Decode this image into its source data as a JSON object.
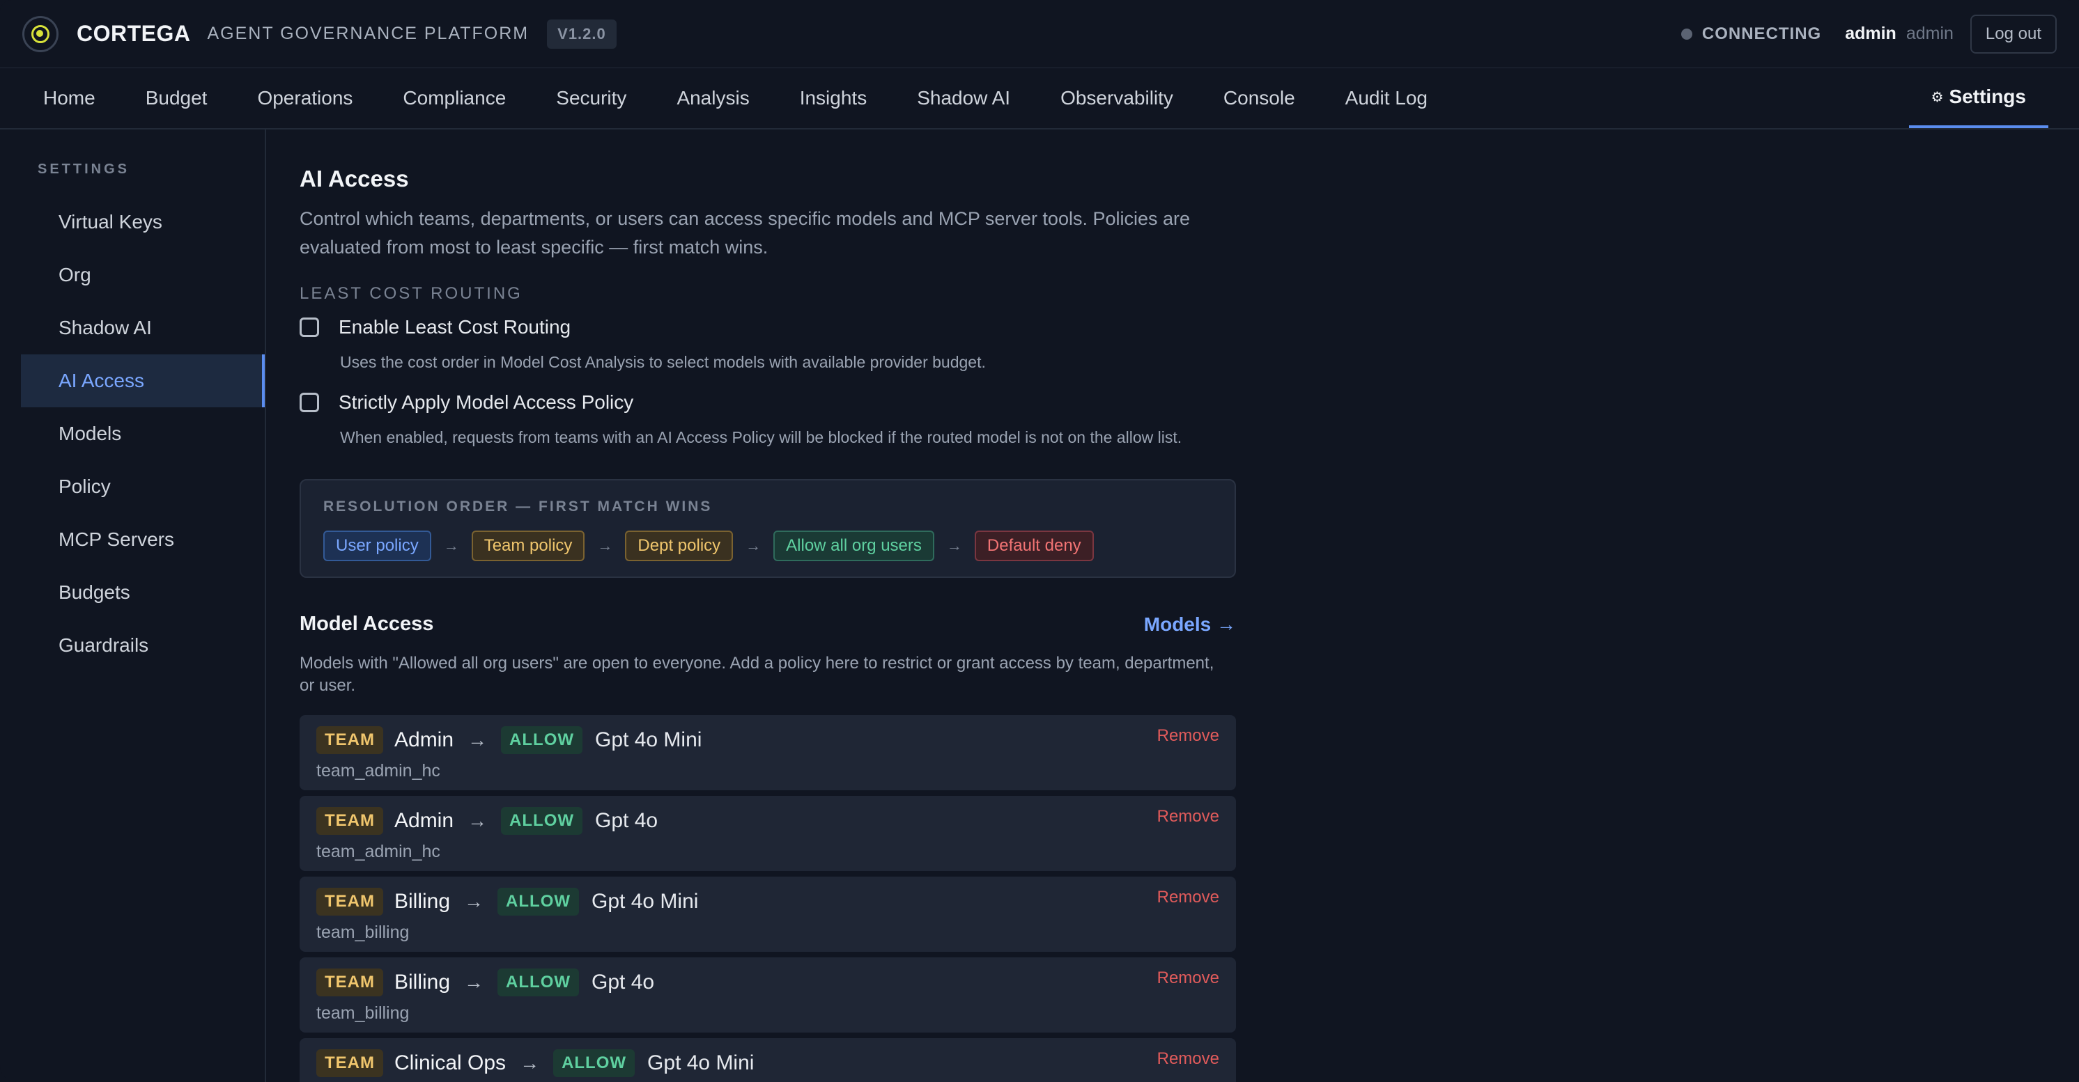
{
  "header": {
    "brand": "CORTEGA",
    "subtitle": "AGENT GOVERNANCE PLATFORM",
    "version": "V1.2.0",
    "status": "CONNECTING",
    "user_name": "admin",
    "user_role": "admin",
    "logout_label": "Log out"
  },
  "nav": {
    "items": [
      "Home",
      "Budget",
      "Operations",
      "Compliance",
      "Security",
      "Analysis",
      "Insights",
      "Shadow AI",
      "Observability",
      "Console",
      "Audit Log"
    ],
    "settings_label": "Settings",
    "settings_icon": "gear-icon"
  },
  "sidebar": {
    "heading": "SETTINGS",
    "items": [
      "Virtual Keys",
      "Org",
      "Shadow AI",
      "AI Access",
      "Models",
      "Policy",
      "MCP Servers",
      "Budgets",
      "Guardrails"
    ],
    "active": "AI Access"
  },
  "main": {
    "title": "AI Access",
    "description": "Control which teams, departments, or users can access specific models and MCP server tools. Policies are evaluated from most to least specific — first match wins.",
    "lcr_heading": "LEAST COST ROUTING",
    "options": [
      {
        "label": "Enable Least Cost Routing",
        "help": "Uses the cost order in Model Cost Analysis to select models with available provider budget.",
        "checked": false
      },
      {
        "label": "Strictly Apply Model Access Policy",
        "help": "When enabled, requests from teams with an AI Access Policy will be blocked if the routed model is not on the allow list.",
        "checked": false
      }
    ],
    "resolution": {
      "heading": "RESOLUTION ORDER — FIRST MATCH WINS",
      "steps": [
        "User policy",
        "Team policy",
        "Dept policy",
        "Allow all org users",
        "Default deny"
      ],
      "arrow": "→"
    },
    "model_access": {
      "title": "Model Access",
      "link_label": "Models →",
      "description": "Models with \"Allowed all org users\" are open to everyone. Add a policy here to restrict or grant access by team, department, or user.",
      "rules": [
        {
          "scope": "TEAM",
          "subject": "Admin",
          "action": "ALLOW",
          "model": "Gpt 4o Mini",
          "id": "team_admin_hc",
          "remove": "Remove"
        },
        {
          "scope": "TEAM",
          "subject": "Admin",
          "action": "ALLOW",
          "model": "Gpt 4o",
          "id": "team_admin_hc",
          "remove": "Remove"
        },
        {
          "scope": "TEAM",
          "subject": "Billing",
          "action": "ALLOW",
          "model": "Gpt 4o Mini",
          "id": "team_billing",
          "remove": "Remove"
        },
        {
          "scope": "TEAM",
          "subject": "Billing",
          "action": "ALLOW",
          "model": "Gpt 4o",
          "id": "team_billing",
          "remove": "Remove"
        },
        {
          "scope": "TEAM",
          "subject": "Clinical Ops",
          "action": "ALLOW",
          "model": "Gpt 4o Mini",
          "id": "",
          "remove": "Remove"
        }
      ]
    }
  }
}
